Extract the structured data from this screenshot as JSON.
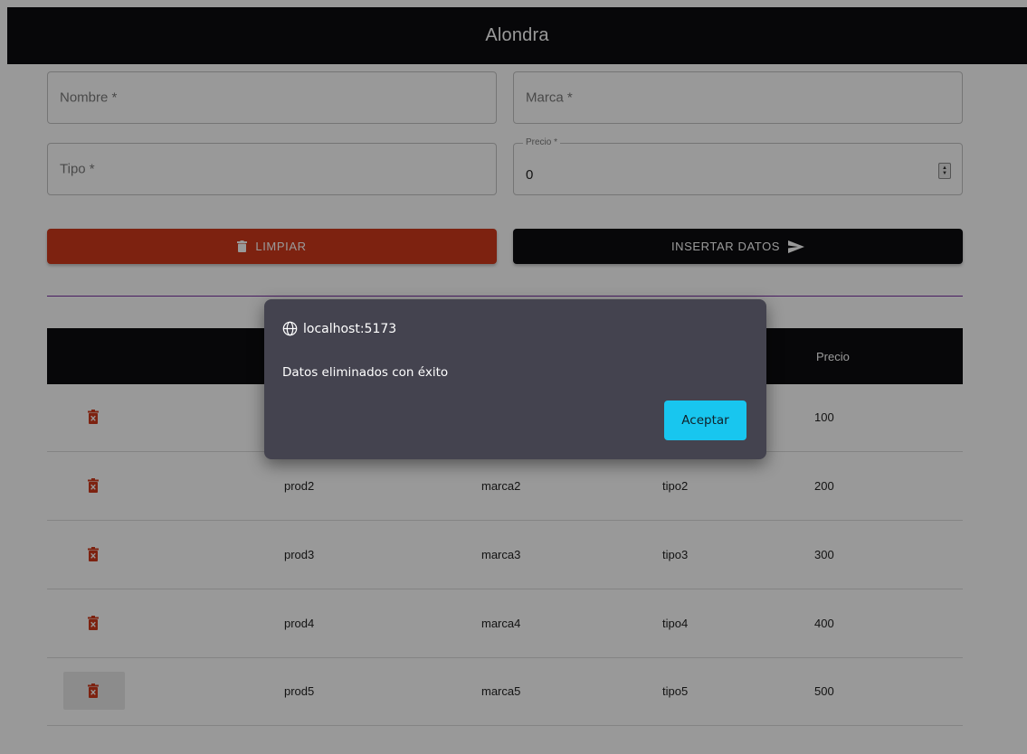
{
  "app": {
    "title": "Alondra"
  },
  "form": {
    "nombre_placeholder": "Nombre *",
    "marca_placeholder": "Marca *",
    "tipo_placeholder": "Tipo *",
    "precio_label": "Precio *",
    "precio_value": "0"
  },
  "buttons": {
    "clear_label": "LIMPIAR",
    "insert_label": "INSERTAR DATOS"
  },
  "table": {
    "headers": {
      "precio": "Precio"
    },
    "rows": [
      {
        "nombre": "",
        "marca": "",
        "tipo": "",
        "precio": "100"
      },
      {
        "nombre": "prod2",
        "marca": "marca2",
        "tipo": "tipo2",
        "precio": "200"
      },
      {
        "nombre": "prod3",
        "marca": "marca3",
        "tipo": "tipo3",
        "precio": "300"
      },
      {
        "nombre": "prod4",
        "marca": "marca4",
        "tipo": "tipo4",
        "precio": "400"
      },
      {
        "nombre": "prod5",
        "marca": "marca5",
        "tipo": "tipo5",
        "precio": "500"
      }
    ]
  },
  "dialog": {
    "origin": "localhost:5173",
    "message": "Datos eliminados con éxito",
    "ok_label": "Aceptar"
  },
  "colors": {
    "clear_button": "#d13a1c",
    "dark": "#0d0d10",
    "divider": "#7b2fa3",
    "accept_button": "#18c6ef",
    "dialog_bg": "#44434f"
  },
  "icons": [
    "trash-icon",
    "send-icon",
    "globe-icon",
    "delete-row-icon",
    "spinner-icon"
  ]
}
